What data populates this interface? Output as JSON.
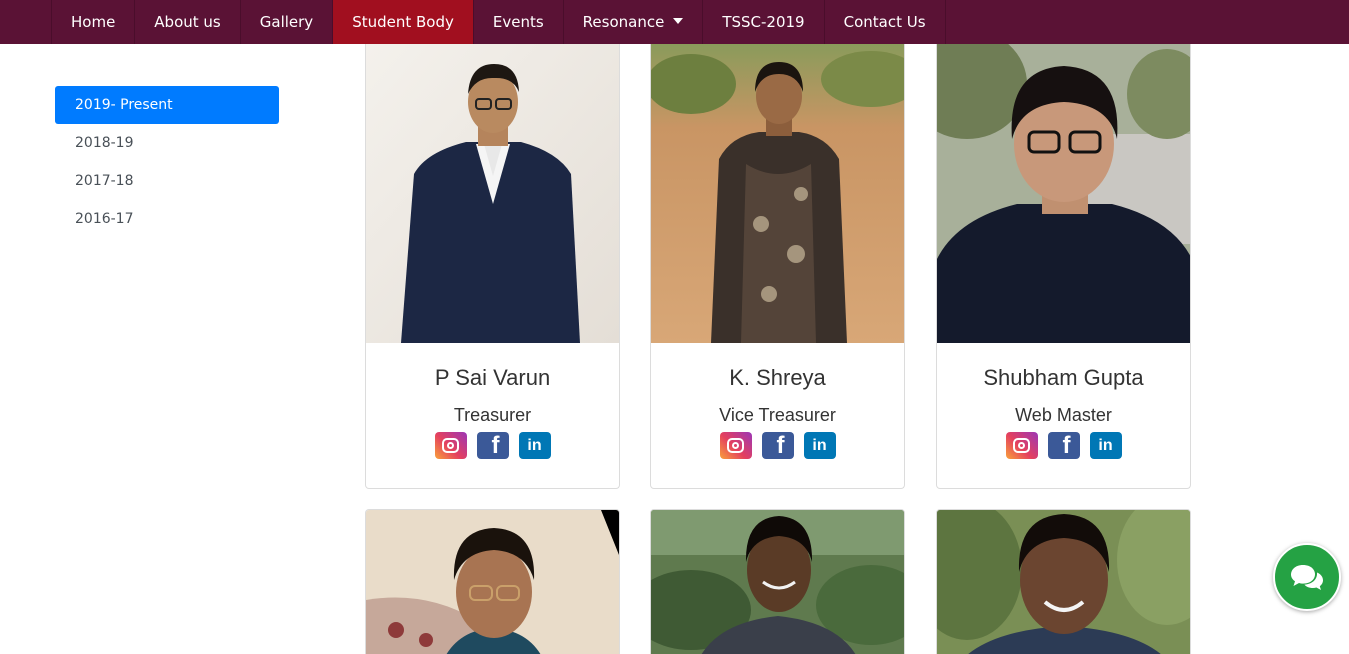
{
  "nav": {
    "items": [
      {
        "label": "Home"
      },
      {
        "label": "About us"
      },
      {
        "label": "Gallery"
      },
      {
        "label": "Student Body"
      },
      {
        "label": "Events"
      },
      {
        "label": "Resonance"
      },
      {
        "label": "TSSC-2019"
      },
      {
        "label": "Contact Us"
      }
    ],
    "active": "Student Body",
    "dropdown_item": "Resonance"
  },
  "sidebar": {
    "items": [
      {
        "label": "2019- Present"
      },
      {
        "label": "2018-19"
      },
      {
        "label": "2017-18"
      },
      {
        "label": "2016-17"
      }
    ],
    "active": "2019- Present"
  },
  "members": [
    {
      "name": "P Sai Varun",
      "role": "Treasurer",
      "socials": [
        "instagram-icon",
        "facebook-icon",
        "linkedin-icon"
      ]
    },
    {
      "name": "K. Shreya",
      "role": "Vice Treasurer",
      "socials": [
        "instagram-icon",
        "facebook-icon",
        "linkedin-icon"
      ]
    },
    {
      "name": "Shubham Gupta",
      "role": "Web Master",
      "socials": [
        "instagram-icon",
        "facebook-icon",
        "linkedin-icon"
      ]
    }
  ],
  "colors": {
    "navbar": "#5a1235",
    "nav_active": "#a10f1f",
    "sidebar_active": "#007bff",
    "chat_button": "#25a244"
  },
  "chat": {
    "icon": "chat-bubbles-icon"
  }
}
